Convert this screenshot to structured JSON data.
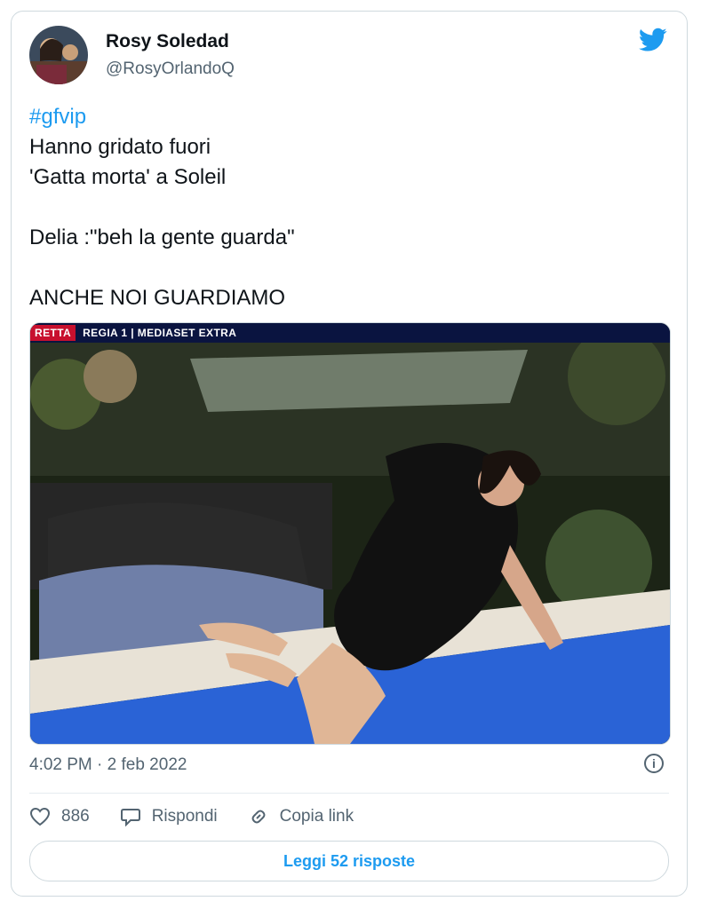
{
  "user": {
    "display_name": "Rosy Soledad",
    "handle": "@RosyOrlandoQ"
  },
  "tweet": {
    "hashtag": "#gfvip",
    "lines": [
      "Hanno gridato fuori",
      "'Gatta morta' a Soleil",
      "",
      "Delia :\"beh la gente guarda\"",
      "",
      "ANCHE NOI GUARDIAMO"
    ]
  },
  "media": {
    "live_label": "RETTA",
    "broadcast_label": "REGIA 1 | MEDIASET EXTRA"
  },
  "meta": {
    "timestamp": "4:02 PM · 2 feb 2022",
    "info_icon": "i"
  },
  "actions": {
    "like_count": "886",
    "reply_label": "Rispondi",
    "copy_link_label": "Copia link"
  },
  "footer": {
    "read_replies_label": "Leggi 52 risposte"
  },
  "colors": {
    "accent": "#1d9bf0",
    "secondary_text": "#536471",
    "border": "#cfd9de"
  }
}
